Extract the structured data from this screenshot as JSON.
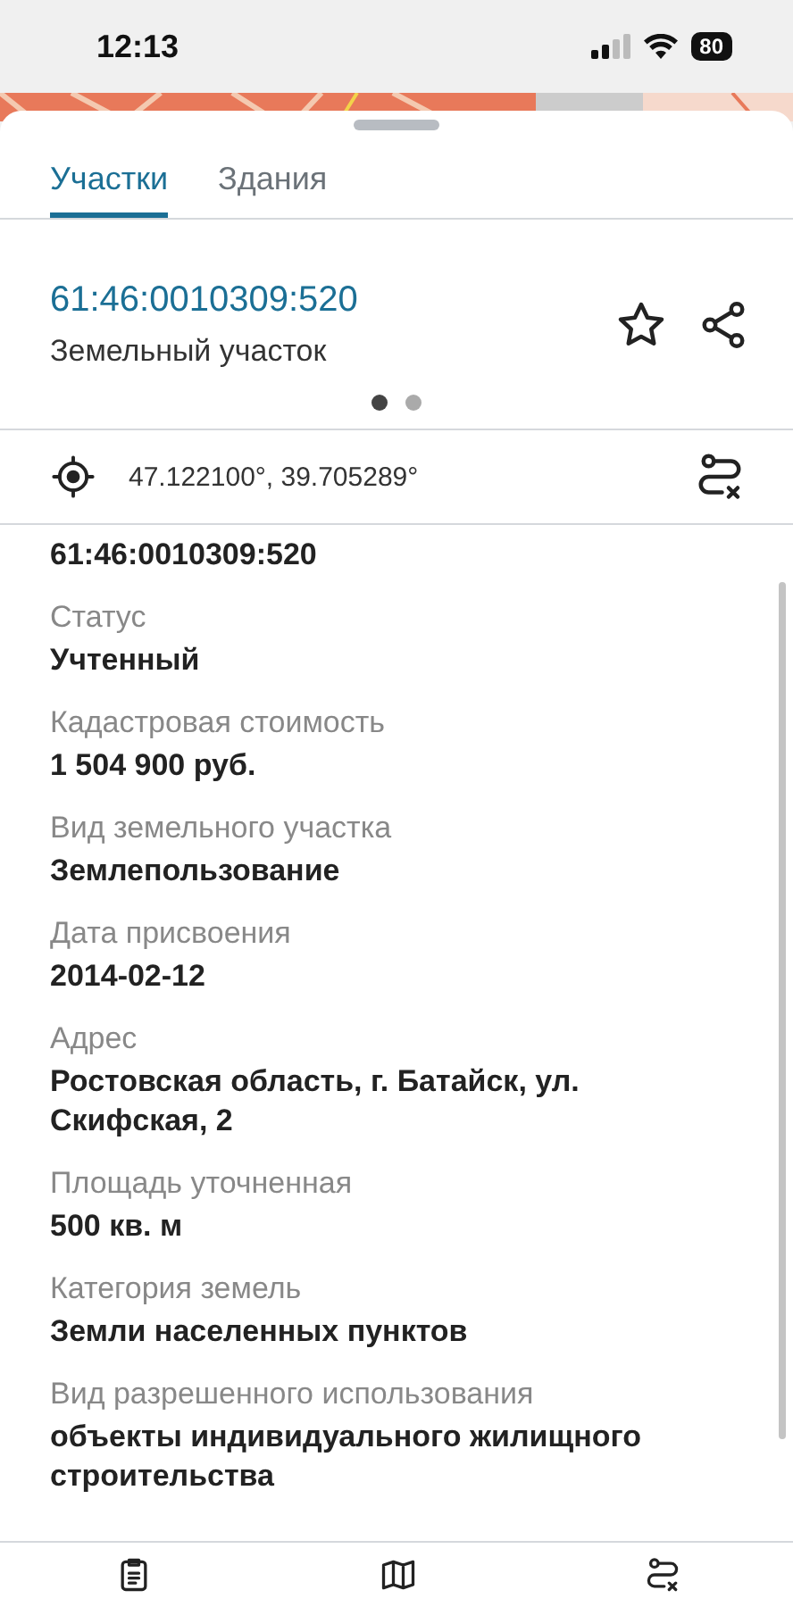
{
  "status_bar": {
    "time": "12:13",
    "battery": "80"
  },
  "tabs": [
    {
      "label": "Участки",
      "selected": true
    },
    {
      "label": "Здания",
      "selected": false
    }
  ],
  "header": {
    "number": "61:46:0010309:520",
    "type": "Земельный участок",
    "pages": [
      {
        "selected": true
      },
      {
        "selected": false
      }
    ]
  },
  "coordinates": "47.122100°, 39.705289°",
  "fields": [
    {
      "value": "61:46:0010309:520"
    },
    {
      "label": "Статус",
      "value": "Учтенный"
    },
    {
      "label": "Кадастровая стоимость",
      "value": "1 504 900 руб."
    },
    {
      "label": "Вид земельного участка",
      "value": "Землепользование"
    },
    {
      "label": "Дата присвоения",
      "value": "2014-02-12"
    },
    {
      "label": "Адрес",
      "value": "Ростовская область, г. Батайск, ул. Скифская, 2"
    },
    {
      "label": "Площадь уточненная",
      "value": "500 кв. м"
    },
    {
      "label": "Категория земель",
      "value": "Земли населенных пунктов"
    },
    {
      "label": "Вид разрешенного использования",
      "value": "объекты индивидуального жилищного строительства"
    }
  ],
  "bottom_nav": [
    {
      "kind": "list"
    },
    {
      "kind": "map"
    },
    {
      "kind": "route"
    }
  ]
}
